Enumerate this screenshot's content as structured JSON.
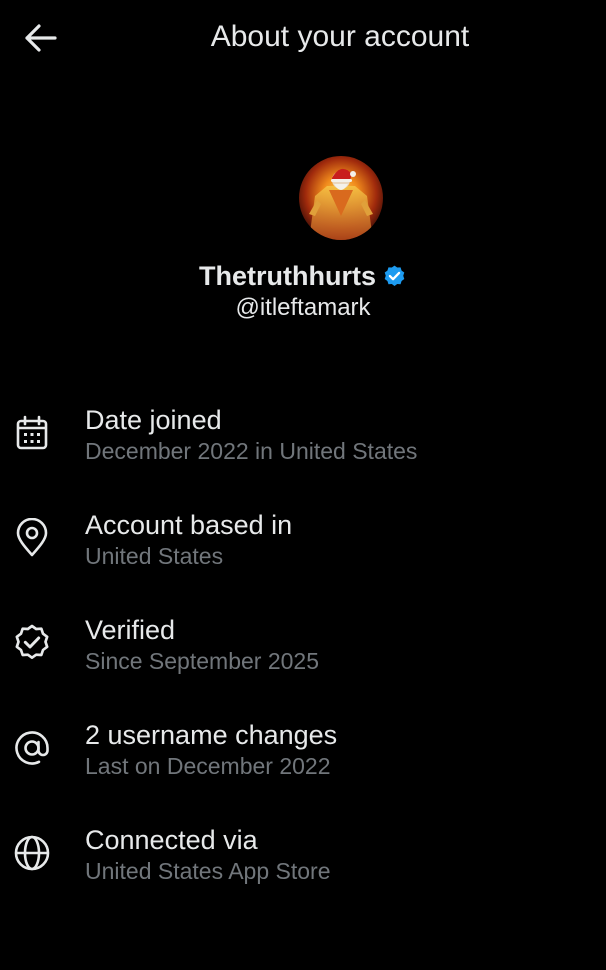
{
  "header": {
    "title": "About your account",
    "back_icon": "arrow-left-icon"
  },
  "profile": {
    "display_name": "Thetruthhurts",
    "handle": "@itleftamark",
    "verified": true,
    "verified_color": "#1d9bf0"
  },
  "info": [
    {
      "icon": "calendar-icon",
      "label": "Date joined",
      "detail": "December 2022 in United States"
    },
    {
      "icon": "location-pin-icon",
      "label": "Account based in",
      "detail": "United States"
    },
    {
      "icon": "verified-badge-icon",
      "label": "Verified",
      "detail": "Since September 2025"
    },
    {
      "icon": "at-sign-icon",
      "label": "2 username changes",
      "detail": "Last on December 2022"
    },
    {
      "icon": "globe-icon",
      "label": "Connected via",
      "detail": "United States App Store"
    }
  ],
  "colors": {
    "background": "#000000",
    "primary_text": "#e7e9ea",
    "secondary_text": "#71767b"
  }
}
